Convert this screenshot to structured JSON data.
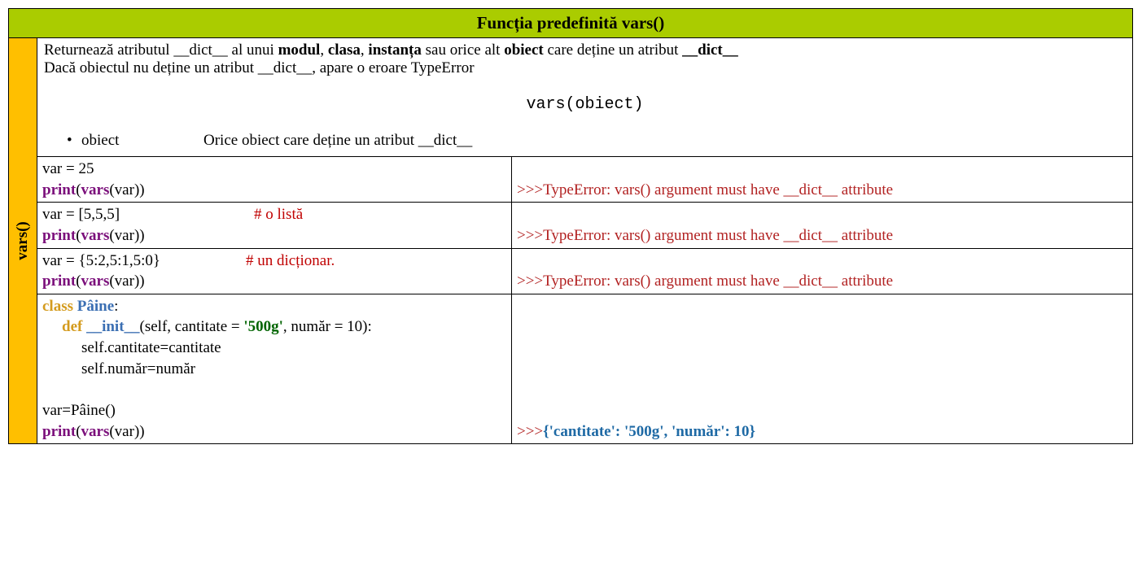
{
  "title": "Funcția predefinită vars()",
  "side_label": "vars()",
  "desc": {
    "l1_a": "Returnează atributul __dict__ al unui ",
    "l1_b1": "modul",
    "l1_c": ", ",
    "l1_b2": "clasa",
    "l1_d": ", ",
    "l1_b3": "instanța",
    "l1_e": " sau orice alt ",
    "l1_b4": "obiect",
    "l1_f": " care deține un atribut ",
    "l1_b5": "__dict__",
    "l2": "Dacă obiectul nu deține un atribut __dict__, apare o eroare TypeError",
    "syntax": "vars(obiect)",
    "param_name": "obiect",
    "param_desc": "Orice obiect care deține un atribut __dict__"
  },
  "ex1": {
    "line1": "var = 25",
    "print": "print",
    "vars": "vars",
    "arg_open": "(",
    "arg_inner_open": "(",
    "arg_var": "var",
    "arg_inner_close": ")",
    "arg_close": ")",
    "out_prompt": ">>>",
    "out_text": "TypeError: vars() argument must have __dict__ attribute"
  },
  "ex2": {
    "line1_a": "var = [5,5,5]",
    "line1_comment": "# o listă",
    "print": "print",
    "vars": "vars",
    "arg_var": "var",
    "out_prompt": ">>>",
    "out_text": "TypeError: vars() argument must have __dict__ attribute"
  },
  "ex3": {
    "line1_a": "var = {5:2,5:1,5:0}",
    "line1_comment": "# un dicționar.",
    "print": "print",
    "vars": "vars",
    "arg_var": "var",
    "out_prompt": ">>>",
    "out_text": "TypeError: vars() argument must have __dict__ attribute"
  },
  "ex4": {
    "kw_class": "class",
    "cls_name": " Pâine",
    "colon": ":",
    "kw_def": "def",
    "init": " __init__",
    "params_a": "(self, cantitate = ",
    "str": "'500g'",
    "params_b": ", număr = 10):",
    "body1": "self.cantitate=cantitate",
    "body2": "self.număr=număr",
    "inst": "var=Pâine()",
    "print": "print",
    "vars": "vars",
    "arg_var": "var",
    "out_prompt": ">>>",
    "out_text": "{'cantitate': '500g', 'număr': 10}"
  }
}
